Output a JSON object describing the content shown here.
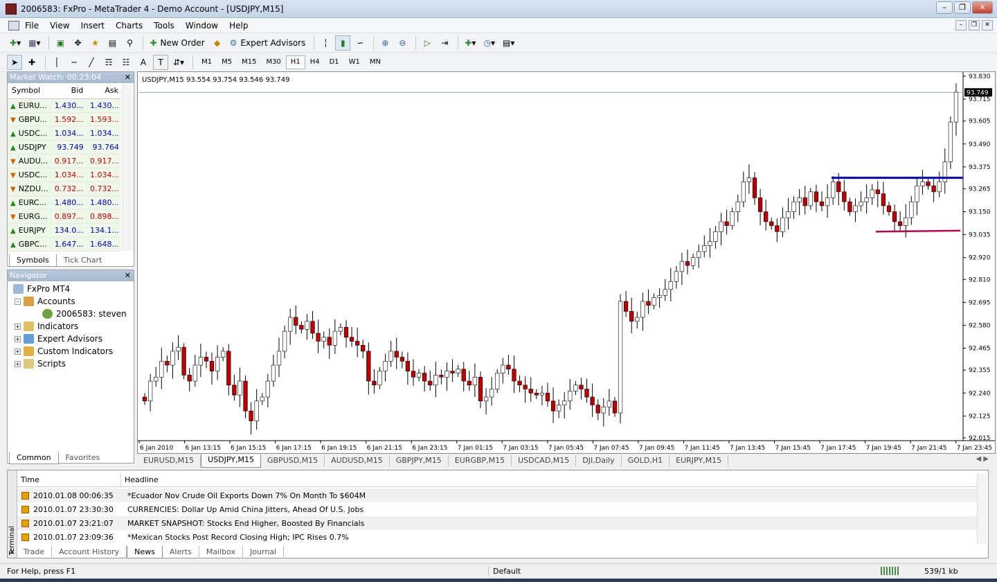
{
  "window": {
    "title": "2006583: FxPro - MetaTrader 4 - Demo Account - [USDJPY,M15]"
  },
  "menu": [
    "File",
    "View",
    "Insert",
    "Charts",
    "Tools",
    "Window",
    "Help"
  ],
  "toolbar": {
    "new_order": "New Order",
    "expert_advisors": "Expert Advisors"
  },
  "drawtools": {
    "text_a": "A",
    "text_t": "T"
  },
  "timeframes": [
    "M1",
    "M5",
    "M15",
    "M30",
    "H1",
    "H4",
    "D1",
    "W1",
    "MN"
  ],
  "active_timeframe": "H1",
  "market_watch": {
    "title": "Market Watch: 00:23:04",
    "headers": {
      "symbol": "Symbol",
      "bid": "Bid",
      "ask": "Ask"
    },
    "rows": [
      {
        "symbol": "EURU...",
        "bid": "1.430...",
        "ask": "1.430...",
        "dir": "up"
      },
      {
        "symbol": "GBPU...",
        "bid": "1.592...",
        "ask": "1.593...",
        "dir": "down"
      },
      {
        "symbol": "USDC...",
        "bid": "1.034...",
        "ask": "1.034...",
        "dir": "up"
      },
      {
        "symbol": "USDJPY",
        "bid": "93.749",
        "ask": "93.764",
        "dir": "up"
      },
      {
        "symbol": "AUDU...",
        "bid": "0.917...",
        "ask": "0.917...",
        "dir": "down"
      },
      {
        "symbol": "USDC...",
        "bid": "1.034...",
        "ask": "1.034...",
        "dir": "down"
      },
      {
        "symbol": "NZDU...",
        "bid": "0.732...",
        "ask": "0.732...",
        "dir": "down"
      },
      {
        "symbol": "EURC...",
        "bid": "1.480...",
        "ask": "1.480...",
        "dir": "up"
      },
      {
        "symbol": "EURG...",
        "bid": "0.897...",
        "ask": "0.898...",
        "dir": "down"
      },
      {
        "symbol": "EURJPY",
        "bid": "134.0...",
        "ask": "134.1...",
        "dir": "up"
      },
      {
        "symbol": "GBPC...",
        "bid": "1.647...",
        "ask": "1.648...",
        "dir": "up"
      }
    ],
    "tabs": [
      "Symbols",
      "Tick Chart"
    ]
  },
  "navigator": {
    "title": "Navigator",
    "root": "FxPro MT4",
    "accounts": "Accounts",
    "account": "2006583: steven",
    "items": [
      "Indicators",
      "Expert Advisors",
      "Custom Indicators",
      "Scripts"
    ],
    "tabs": [
      "Common",
      "Favorites"
    ]
  },
  "chart": {
    "header": "USDJPY,M15  93.554 93.754 93.546 93.749",
    "current_price": "93.749",
    "price_ticks": [
      "93.830",
      "93.715",
      "93.605",
      "93.490",
      "93.375",
      "93.265",
      "93.150",
      "93.035",
      "92.920",
      "92.810",
      "92.695",
      "92.580",
      "92.465",
      "92.355",
      "92.240",
      "92.125",
      "92.015"
    ],
    "time_ticks": [
      "6 Jan 2010",
      "6 Jan 13:15",
      "6 Jan 15:15",
      "6 Jan 17:15",
      "6 Jan 19:15",
      "6 Jan 21:15",
      "6 Jan 23:15",
      "7 Jan 01:15",
      "7 Jan 03:15",
      "7 Jan 05:45",
      "7 Jan 07:45",
      "7 Jan 09:45",
      "7 Jan 11:45",
      "7 Jan 13:45",
      "7 Jan 15:45",
      "7 Jan 17:45",
      "7 Jan 19:45",
      "7 Jan 21:45",
      "7 Jan 23:45"
    ],
    "colors": {
      "bull": "#ffffff",
      "bear": "#c00000",
      "resistance": "#0000cc",
      "support": "#c8004a"
    }
  },
  "chart_tabs": [
    "EURUSD,M15",
    "USDJPY,M15",
    "GBPUSD,M15",
    "AUDUSD,M15",
    "GBPJPY,M15",
    "EURGBP,M15",
    "USDCAD,M15",
    "DJI,Daily",
    "GOLD,H1",
    "EURJPY,M15"
  ],
  "active_chart_tab": "USDJPY,M15",
  "terminal": {
    "side_label": "Terminal",
    "headers": {
      "time": "Time",
      "headline": "Headline"
    },
    "news": [
      {
        "time": "2010.01.08 00:06:35",
        "headline": "*Ecuador Nov Crude Oil Exports Down 7% On Month To $604M"
      },
      {
        "time": "2010.01.07 23:30:30",
        "headline": "CURRENCIES: Dollar Up Amid China Jitters, Ahead Of U.S. Jobs"
      },
      {
        "time": "2010.01.07 23:21:07",
        "headline": "MARKET SNAPSHOT: Stocks End Higher, Boosted By Financials"
      },
      {
        "time": "2010.01.07 23:09:36",
        "headline": "*Mexican Stocks Post Record Closing High; IPC Rises 0.7%"
      }
    ],
    "tabs": [
      "Trade",
      "Account History",
      "News",
      "Alerts",
      "Mailbox",
      "Journal"
    ],
    "active_tab": "News"
  },
  "status": {
    "help": "For Help, press F1",
    "profile": "Default",
    "traffic": "539/1 kb"
  }
}
